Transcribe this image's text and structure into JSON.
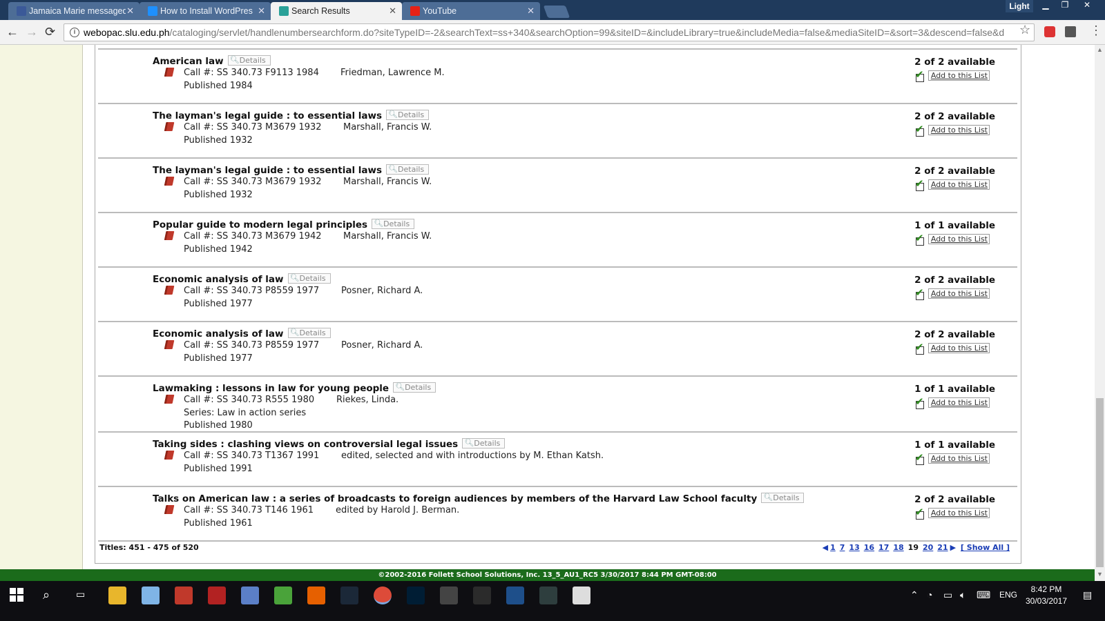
{
  "browser": {
    "tabs": [
      {
        "title": "Jamaica Marie messaged",
        "favicon_color": "#3b5998",
        "active": false
      },
      {
        "title": "How to Install WordPres",
        "favicon_color": "#1e90ff",
        "active": false
      },
      {
        "title": "Search Results",
        "favicon_color": "#2aa198",
        "active": true
      },
      {
        "title": "YouTube",
        "favicon_color": "#e62117",
        "active": false
      }
    ],
    "profile_label": "Light",
    "url_host": "webopac.slu.edu.ph",
    "url_rest": "/cataloging/servlet/handlenumbersearchform.do?siteTypeID=-2&searchText=ss+340&searchOption=99&siteID=&includeLibrary=true&includeMedia=false&mediaSiteID=&sort=3&descend=false&d"
  },
  "results": [
    {
      "title": "American law",
      "call_no": "Call #: SS 340.73 F9113 1984",
      "author": "Friedman, Lawrence M.",
      "author_x": 493,
      "series": "",
      "published": "Published 1984",
      "availability": "2 of 2 available"
    },
    {
      "title": "The layman's legal guide : to essential laws",
      "call_no": "Call #: SS 340.73 M3679 1932",
      "author": "Marshall, Francis W.",
      "author_x": 497,
      "series": "",
      "published": "Published 1932",
      "availability": "2 of 2 available"
    },
    {
      "title": "The layman's legal guide : to essential laws",
      "call_no": "Call #: SS 340.73 M3679 1932",
      "author": "Marshall, Francis W.",
      "author_x": 497,
      "series": "",
      "published": "Published 1932",
      "availability": "2 of 2 available"
    },
    {
      "title": "Popular guide to modern legal principles",
      "call_no": "Call #: SS 340.73 M3679 1942",
      "author": "Marshall, Francis W.",
      "author_x": 497,
      "series": "",
      "published": "Published 1942",
      "availability": "1 of 1 available"
    },
    {
      "title": "Economic analysis of law",
      "call_no": "Call #: SS 340.73 P8559 1977",
      "author": "Posner, Richard A.",
      "author_x": 494,
      "series": "",
      "published": "Published 1977",
      "availability": "2 of 2 available"
    },
    {
      "title": "Economic analysis of law",
      "call_no": "Call #: SS 340.73 P8559 1977",
      "author": "Posner, Richard A.",
      "author_x": 494,
      "series": "",
      "published": "Published 1977",
      "availability": "2 of 2 available"
    },
    {
      "title": "Lawmaking : lessons in law for young people",
      "call_no": "Call #: SS 340.73 R555 1980",
      "author": "Riekes, Linda.",
      "author_x": 487,
      "series": "Series: Law in action series",
      "published": "Published 1980",
      "availability": "1 of 1 available"
    },
    {
      "title": "Taking sides : clashing views on controversial legal issues",
      "call_no": "Call #: SS 340.73 T1367 1991",
      "author": "edited, selected and with introductions by M. Ethan Katsh.",
      "author_x": 494,
      "series": "",
      "published": "Published 1991",
      "availability": "1 of 1 available"
    },
    {
      "title": "Talks on American law : a series of broadcasts to foreign audiences by members of the Harvard Law School faculty",
      "call_no": "Call #: SS 340.73 T146 1961",
      "author": "edited by Harold J. Berman.",
      "author_x": 486,
      "series": "",
      "published": "Published 1961",
      "availability": "2 of 2 available"
    }
  ],
  "labels": {
    "details": "Details",
    "add_to_list": "Add to this List"
  },
  "footer": {
    "titles_count": "Titles: 451 - 475 of 520",
    "pages": [
      "1",
      "7",
      "13",
      "16",
      "17",
      "18",
      "19",
      "20",
      "21"
    ],
    "current_page": "19",
    "show_all": "[ Show All ]",
    "copyright": "©2002-2016  Follett School Solutions, Inc.     13_5_AU1_RC5     3/30/2017 8:44 PM GMT-08:00"
  },
  "taskbar": {
    "apps": [
      {
        "name": "file-explorer-icon",
        "color": "#e8b62c"
      },
      {
        "name": "3d-builder-icon",
        "color": "#7fb4e6"
      },
      {
        "name": "app-red-icon",
        "color": "#c0392b"
      },
      {
        "name": "app-red2-icon",
        "color": "#b22222"
      },
      {
        "name": "app-blue-icon",
        "color": "#5b7fc7"
      },
      {
        "name": "utorrent-icon",
        "color": "#4aa33a"
      },
      {
        "name": "firefox-icon",
        "color": "#e66000"
      },
      {
        "name": "steam-icon",
        "color": "#1b2838"
      },
      {
        "name": "chrome-icon",
        "color": "#dd4b39"
      },
      {
        "name": "photoshop-icon",
        "color": "#001d34"
      },
      {
        "name": "obs-icon",
        "color": "#444"
      },
      {
        "name": "app-frame-icon",
        "color": "#2b2b2b"
      },
      {
        "name": "app-grid-icon",
        "color": "#1e4f8a"
      },
      {
        "name": "nox-icon",
        "color": "#2e3e3e"
      },
      {
        "name": "photos-icon",
        "color": "#ddd"
      }
    ],
    "lang": "ENG",
    "time": "8:42 PM",
    "date": "30/03/2017"
  }
}
